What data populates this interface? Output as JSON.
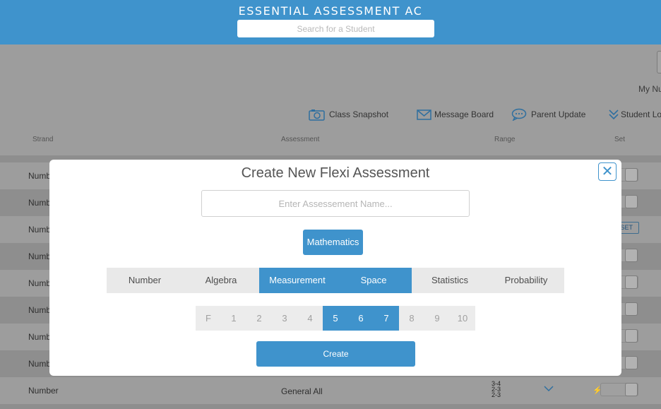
{
  "header": {
    "title": "ESSENTIAL ASSESSMENT AC",
    "search_placeholder": "Search for a Student"
  },
  "toolbar": {
    "my_label": "My Nu",
    "actions": [
      {
        "label": "Class Snapshot",
        "icon": "camera-icon"
      },
      {
        "label": "Message Board",
        "icon": "envelope-icon"
      },
      {
        "label": "Parent Update",
        "icon": "chat-bubble-icon"
      },
      {
        "label": "Student Lo",
        "icon": "double-chevron-down-icon"
      }
    ]
  },
  "table": {
    "columns": [
      "Strand",
      "Assessment",
      "Range",
      "Set"
    ],
    "rows": [
      {
        "strand": "Numb"
      },
      {
        "strand": "Numb"
      },
      {
        "strand": "Numb",
        "badge": "SET"
      },
      {
        "strand": "Numb"
      },
      {
        "strand": "Numb"
      },
      {
        "strand": "Numb"
      },
      {
        "strand": "Numb"
      },
      {
        "strand": "Numb"
      },
      {
        "strand": "Number",
        "assessment": "General All",
        "range": [
          "3-4",
          "2-3",
          "2-3"
        ],
        "marker": "⚡"
      }
    ]
  },
  "modal": {
    "title": "Create New Flexi Assessment",
    "name_placeholder": "Enter Assessement Name...",
    "subject": "Mathematics",
    "strands": [
      {
        "label": "Number",
        "selected": false
      },
      {
        "label": "Algebra",
        "selected": false
      },
      {
        "label": "Measurement",
        "selected": true
      },
      {
        "label": "Space",
        "selected": true
      },
      {
        "label": "Statistics",
        "selected": false
      },
      {
        "label": "Probability",
        "selected": false
      }
    ],
    "levels": [
      {
        "label": "F",
        "selected": false
      },
      {
        "label": "1",
        "selected": false
      },
      {
        "label": "2",
        "selected": false
      },
      {
        "label": "3",
        "selected": false
      },
      {
        "label": "4",
        "selected": false
      },
      {
        "label": "5",
        "selected": true
      },
      {
        "label": "6",
        "selected": true
      },
      {
        "label": "7",
        "selected": true
      },
      {
        "label": "8",
        "selected": false
      },
      {
        "label": "9",
        "selected": false
      },
      {
        "label": "10",
        "selected": false
      }
    ],
    "create_label": "Create",
    "close_symbol": "✕"
  },
  "colors": {
    "brand": "#3f93cc",
    "overlay": "#9d9d9d"
  }
}
